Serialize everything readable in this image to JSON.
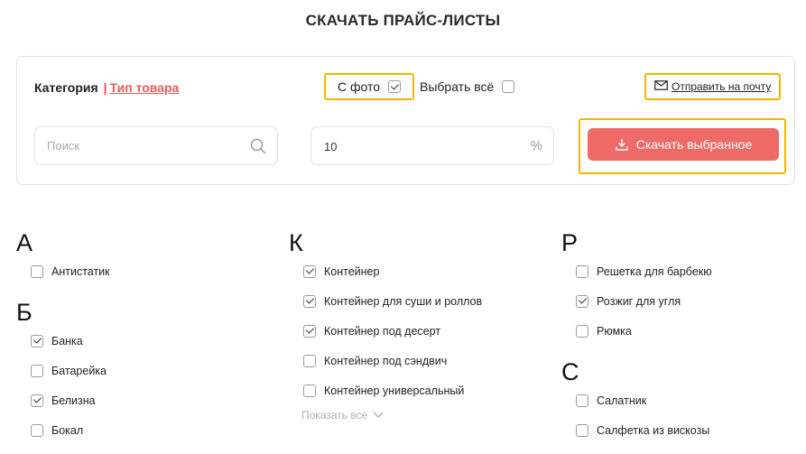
{
  "page": {
    "title": "СКАЧАТЬ ПРАЙС-ЛИСТЫ"
  },
  "filters": {
    "tab_category": "Категория",
    "tab_separator": "|",
    "tab_product_type": "Тип товара",
    "with_photo_label": "С фото",
    "with_photo_checked": true,
    "select_all_label": "Выбрать всё",
    "select_all_checked": false,
    "send_email_label": "Отправить на почту"
  },
  "search": {
    "placeholder": "Поиск",
    "value": ""
  },
  "markup": {
    "value": "10",
    "unit": "%"
  },
  "download": {
    "label": "Скачать выбранное"
  },
  "colors": {
    "accent": "#ee6a66",
    "highlight": "#f5b400",
    "link": "#e85c5c"
  },
  "columns": [
    {
      "groups": [
        {
          "letter": "А",
          "items": [
            {
              "label": "Антистатик",
              "checked": false
            }
          ]
        },
        {
          "letter": "Б",
          "items": [
            {
              "label": "Банка",
              "checked": true
            },
            {
              "label": "Батарейка",
              "checked": false
            },
            {
              "label": "Белизна",
              "checked": true
            },
            {
              "label": "Бокал",
              "checked": false
            }
          ]
        }
      ]
    },
    {
      "groups": [
        {
          "letter": "К",
          "items": [
            {
              "label": "Контейнер",
              "checked": true
            },
            {
              "label": "Контейнер для суши и роллов",
              "checked": true
            },
            {
              "label": "Контейнер под десерт",
              "checked": true
            },
            {
              "label": "Контейнер под сэндвич",
              "checked": false
            },
            {
              "label": "Контейнер универсальный",
              "checked": false
            }
          ],
          "show_all": "Показать все"
        }
      ]
    },
    {
      "groups": [
        {
          "letter": "Р",
          "items": [
            {
              "label": "Решетка для барбекю",
              "checked": false
            },
            {
              "label": "Розжиг для угля",
              "checked": true
            },
            {
              "label": "Рюмка",
              "checked": false
            }
          ]
        },
        {
          "letter": "С",
          "items": [
            {
              "label": "Салатник",
              "checked": false
            },
            {
              "label": "Салфетка из вискозы",
              "checked": false
            }
          ]
        }
      ]
    }
  ]
}
